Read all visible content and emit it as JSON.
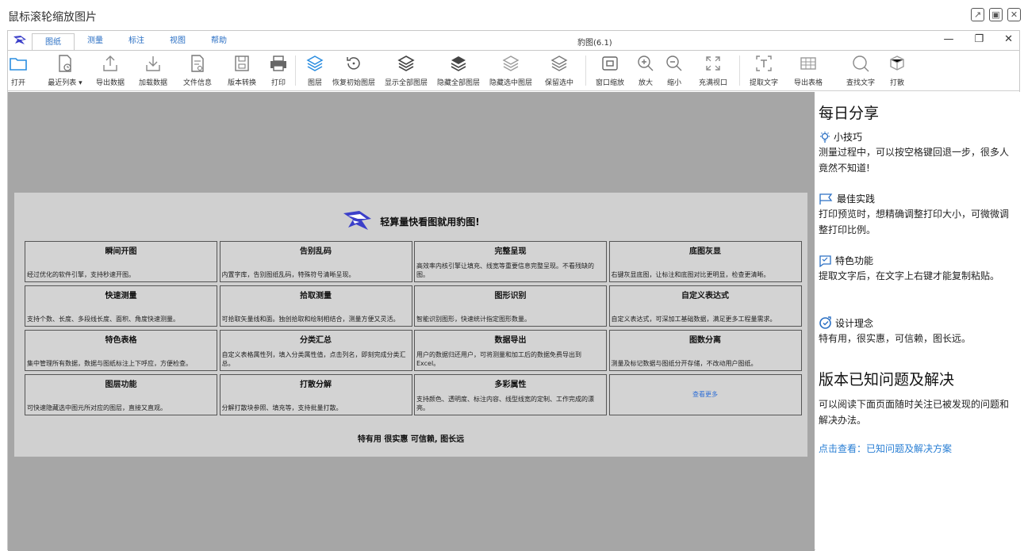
{
  "outer_window": {
    "title": "鼠标滚轮缩放图片"
  },
  "app": {
    "doc_title": "豹图(6.1)",
    "tabs": [
      "图纸",
      "测量",
      "标注",
      "视图",
      "帮助"
    ],
    "toolbar": [
      {
        "label": "打开",
        "icon": "folder-icon"
      },
      {
        "label": "最近列表",
        "icon": "recent-file-icon"
      },
      {
        "label": "导出数据",
        "icon": "export-icon"
      },
      {
        "label": "加载数据",
        "icon": "import-icon"
      },
      {
        "label": "文件信息",
        "icon": "file-info-icon"
      },
      {
        "label": "版本转换",
        "icon": "version-convert-icon"
      },
      {
        "label": "打印",
        "icon": "printer-icon"
      },
      {
        "label": "图层",
        "icon": "layers-icon"
      },
      {
        "label": "恢复初始图层",
        "icon": "restore-icon"
      },
      {
        "label": "显示全部图层",
        "icon": "show-layers-icon"
      },
      {
        "label": "隐藏全部图层",
        "icon": "hide-layers-icon"
      },
      {
        "label": "隐藏选中图层",
        "icon": "hide-selected-layers-icon"
      },
      {
        "label": "保留选中",
        "icon": "keep-selected-icon"
      },
      {
        "label": "窗口缩放",
        "icon": "window-zoom-icon"
      },
      {
        "label": "放大",
        "icon": "zoom-in-icon"
      },
      {
        "label": "缩小",
        "icon": "zoom-out-icon"
      },
      {
        "label": "充满视口",
        "icon": "fit-view-icon"
      },
      {
        "label": "提取文字",
        "icon": "extract-text-icon"
      },
      {
        "label": "导出表格",
        "icon": "export-table-icon"
      },
      {
        "label": "查找文字",
        "icon": "find-text-icon"
      },
      {
        "label": "打散",
        "icon": "explode-icon"
      }
    ],
    "accent": "#2a6fc4"
  },
  "splash": {
    "title": "轻算量快看图就用豹图!",
    "footer": "特有用 很实惠 可信赖, 图长远",
    "more_label": "查看更多",
    "features": [
      {
        "title": "瞬间开图",
        "desc": "经过优化的软件引擎，支持秒速开图。"
      },
      {
        "title": "告别乱码",
        "desc": "内置字库，告别图纸乱码，特殊符号清晰呈现。"
      },
      {
        "title": "完整呈现",
        "desc": "高效率内核引擎让填充、线宽等重要信息完整呈现。不看残缺的图。"
      },
      {
        "title": "底图灰显",
        "desc": "右键灰显底图，让标注和底图对比更明显，检查更清晰。"
      },
      {
        "title": "快速测量",
        "desc": "支持个数、长度、多段线长度、面积、角度快速测量。"
      },
      {
        "title": "拾取测量",
        "desc": "可拾取矢量线和面。独创拾取和绘制相结合，测量方便又灵活。"
      },
      {
        "title": "图形识别",
        "desc": "智能识别图形，快速统计指定图形数量。"
      },
      {
        "title": "自定义表达式",
        "desc": "自定义表达式，可深加工基础数据，满足更多工程量需求。"
      },
      {
        "title": "特色表格",
        "desc": "集中管理所有数据，数据与图纸标注上下呼应，方便检查。"
      },
      {
        "title": "分类汇总",
        "desc": "自定义表格属性列，填入分类属性值，点击列名，即刻完成分类汇总。"
      },
      {
        "title": "数据导出",
        "desc": "用户的数据归还用户，可将测量和加工后的数据免费导出到Excel。"
      },
      {
        "title": "图数分离",
        "desc": "测量及标记数据与图纸分开存储，不改动用户图纸。"
      },
      {
        "title": "图层功能",
        "desc": "可快速隐藏选中图元所对应的图层，直接又直观。"
      },
      {
        "title": "打散分解",
        "desc": "分解打散块参照、填充等，支持批量打散。"
      },
      {
        "title": "多彩属性",
        "desc": "支持颜色、透明度、标注内容、线型线宽的定制、工作完成的漂亮。"
      }
    ]
  },
  "sidebar": {
    "title": "每日分享",
    "sections": [
      {
        "icon": "lightbulb-icon",
        "title": "小技巧",
        "text": "测量过程中，可以按空格键回退一步，很多人竟然不知道!"
      },
      {
        "icon": "flag-icon",
        "title": "最佳实践",
        "text": "打印预览时，想精确调整打印大小，可微微调整打印比例。"
      },
      {
        "icon": "feature-icon",
        "title": "特色功能",
        "text": "提取文字后，在文字上右键才能复制粘贴。"
      },
      {
        "icon": "design-icon",
        "title": "设计理念",
        "text": "特有用，很实惠，可信赖，图长远。"
      }
    ],
    "issues_title": "版本已知问题及解决",
    "issues_text": "可以阅读下面页面随时关注已被发现的问题和解决办法。",
    "issues_link": "点击查看：已知问题及解决方案"
  }
}
